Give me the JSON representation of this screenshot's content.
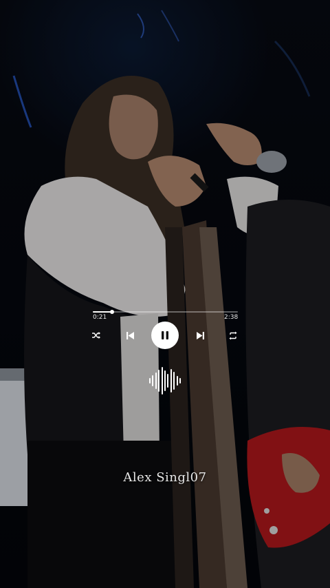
{
  "player": {
    "elapsed": "0:21",
    "duration": "2:38",
    "progress": 0.133,
    "state": "playing",
    "icons": {
      "shuffle": "shuffle-icon",
      "previous": "skip-previous-icon",
      "play_pause": "pause-icon",
      "next": "skip-next-icon",
      "repeat": "repeat-icon",
      "waveform": "audio-waveform-icon"
    },
    "accent": "#ffffff"
  },
  "watermark": {
    "text": "Alex Singl07"
  }
}
